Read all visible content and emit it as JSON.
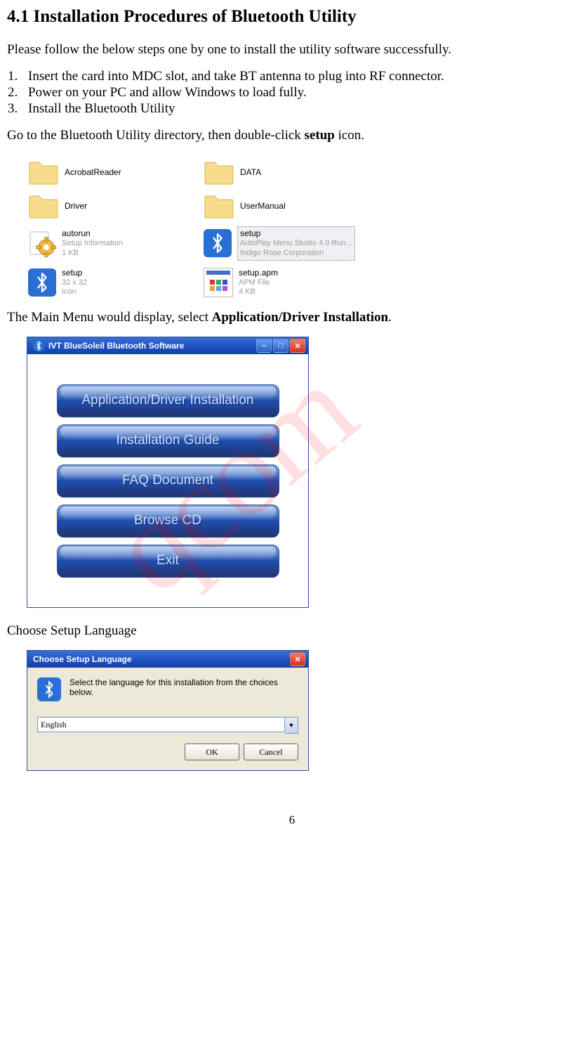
{
  "heading": "4.1 Installation Procedures of Bluetooth Utility",
  "intro": "Please follow the below steps one by one to install the utility software successfully.",
  "steps": [
    "Insert the card into MDC slot, and take BT antenna to plug into RF connector.",
    "Power on your PC and allow Windows to load fully.",
    "Install the Bluetooth Utility"
  ],
  "go_to_pre": "Go to the Bluetooth Utility directory, then double-click ",
  "go_to_bold": "setup",
  "go_to_post": " icon.",
  "files": {
    "acrobat": {
      "name": "AcrobatReader"
    },
    "data": {
      "name": "DATA"
    },
    "driver": {
      "name": "Driver"
    },
    "usermanual": {
      "name": "UserManual"
    },
    "autorun": {
      "name": "autorun",
      "line2": "Setup Information",
      "line3": "1 KB"
    },
    "setup_exe": {
      "name": "setup",
      "line2": "AutoPlay Menu Studio 4.0 Run...",
      "line3": "Indigo Rose Corporation"
    },
    "setup_ico": {
      "name": "setup",
      "line2": "32 x 32",
      "line3": "Icon"
    },
    "setup_apm": {
      "name": "setup.apm",
      "line2": "APM File",
      "line3": "4 KB"
    }
  },
  "mainmenu_pre": "The Main Menu would display, select ",
  "mainmenu_bold": "Application/Driver Installation",
  "mainmenu_post": ".",
  "installer": {
    "title": "IVT BlueSoleil Bluetooth Software",
    "btn1": "Application/Driver Installation",
    "btn2": "Installation Guide",
    "btn3": "FAQ Document",
    "btn4": "Browse CD",
    "btn5": "Exit"
  },
  "choose_lang_label": "Choose Setup Language",
  "lang_dialog": {
    "title": "Choose Setup Language",
    "prompt": "Select the language for this installation from the choices below.",
    "value": "English",
    "ok": "OK",
    "cancel": "Cancel"
  },
  "page_number": "6"
}
